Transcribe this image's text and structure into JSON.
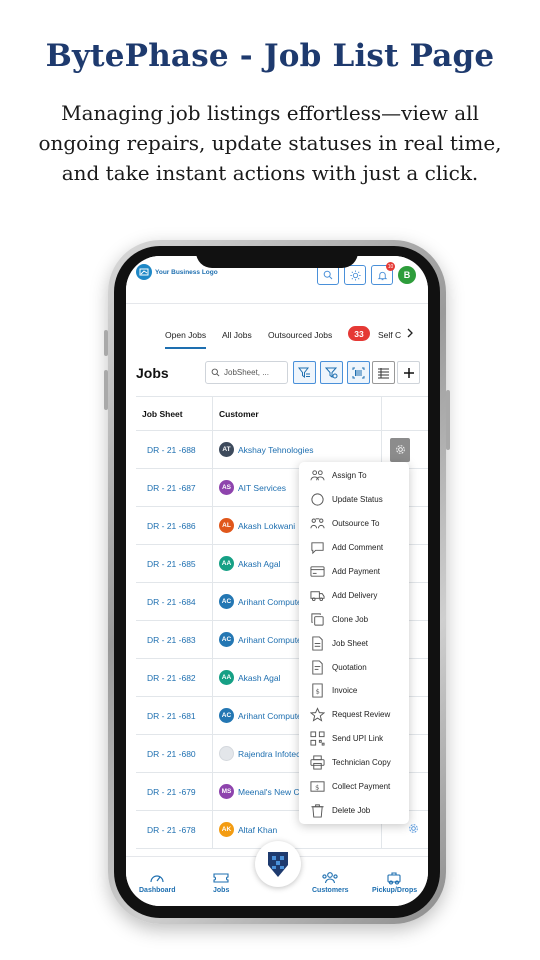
{
  "page": {
    "headline": "BytePhase - Job List Page",
    "description": "Managing job listings effortless—view all ongoing repairs, update statuses in real time, and take instant actions with just a click."
  },
  "appbar": {
    "logo_text": "Your Business Logo",
    "notification_count": "10",
    "user_initial": "B",
    "icons": [
      "search-icon",
      "sun-icon",
      "bell-icon"
    ]
  },
  "tabs": {
    "items": [
      "Open Jobs",
      "All Jobs",
      "Outsourced Jobs",
      "Self C"
    ],
    "active": "Open Jobs",
    "count": "33"
  },
  "toolbar": {
    "title": "Jobs",
    "search_placeholder": "JobSheet, ...",
    "icons": [
      "filter-icon",
      "filter-settings-icon",
      "barcode-scan-icon",
      "list-view-icon",
      "plus-icon"
    ]
  },
  "table": {
    "headers": [
      "Job Sheet",
      "Customer"
    ],
    "rows": [
      {
        "sheet": "DR - 21 -688",
        "initials": "AT",
        "customer": "Akshay Tehnologies",
        "color": "#3d4a5c"
      },
      {
        "sheet": "DR - 21 -687",
        "initials": "AS",
        "customer": "AIT Services",
        "color": "#8e44ad"
      },
      {
        "sheet": "DR - 21 -686",
        "initials": "AL",
        "customer": "Akash Lokwani",
        "color": "#e0571b"
      },
      {
        "sheet": "DR - 21 -685",
        "initials": "AA",
        "customer": "Akash Agal",
        "color": "#16a085"
      },
      {
        "sheet": "DR - 21 -684",
        "initials": "AC",
        "customer": "Arihant Computers",
        "color": "#2477b3"
      },
      {
        "sheet": "DR - 21 -683",
        "initials": "AC",
        "customer": "Arihant Computers",
        "color": "#2477b3"
      },
      {
        "sheet": "DR - 21 -682",
        "initials": "AA",
        "customer": "Akash Agal",
        "color": "#16a085"
      },
      {
        "sheet": "DR - 21 -681",
        "initials": "AC",
        "customer": "Arihant Computers",
        "color": "#2477b3"
      },
      {
        "sheet": "DR - 21 -680",
        "initials": "",
        "customer": "Rajendra Infotech",
        "color": "#e3e6ea"
      },
      {
        "sheet": "DR - 21 -679",
        "initials": "MS",
        "customer": "Meenal's New Co",
        "color": "#8e44ad"
      },
      {
        "sheet": "DR - 21 -678",
        "initials": "AK",
        "customer": "Altaf Khan",
        "color": "#f39c12"
      }
    ]
  },
  "menu": {
    "items": [
      {
        "label": "Assign To",
        "icon": "assign-users-icon"
      },
      {
        "label": "Update Status",
        "icon": "status-circle-icon"
      },
      {
        "label": "Outsource To",
        "icon": "outsource-users-icon"
      },
      {
        "label": "Add Comment",
        "icon": "comment-icon"
      },
      {
        "label": "Add Payment",
        "icon": "payment-card-icon"
      },
      {
        "label": "Add Delivery",
        "icon": "delivery-truck-icon"
      },
      {
        "label": "Clone Job",
        "icon": "clone-icon"
      },
      {
        "label": "Job Sheet",
        "icon": "document-icon"
      },
      {
        "label": "Quotation",
        "icon": "quotation-icon"
      },
      {
        "label": "Invoice",
        "icon": "invoice-icon"
      },
      {
        "label": "Request Review",
        "icon": "star-icon"
      },
      {
        "label": "Send UPI Link",
        "icon": "qr-code-icon"
      },
      {
        "label": "Technician Copy",
        "icon": "printer-icon"
      },
      {
        "label": "Collect Payment",
        "icon": "cash-icon"
      },
      {
        "label": "Delete Job",
        "icon": "trash-icon"
      }
    ]
  },
  "bottom_nav": {
    "items": [
      {
        "label": "Dashboard",
        "icon": "dashboard-gauge-icon"
      },
      {
        "label": "Jobs",
        "icon": "ticket-icon"
      },
      {
        "label": "Customers",
        "icon": "customers-icon"
      },
      {
        "label": "Pickup/Drops",
        "icon": "pickup-truck-icon"
      }
    ],
    "center_icon": "app-logo-icon"
  },
  "colors": {
    "brand_blue": "#1e6fb0",
    "headline": "#1e3a6e",
    "badge_red": "#e53935"
  }
}
